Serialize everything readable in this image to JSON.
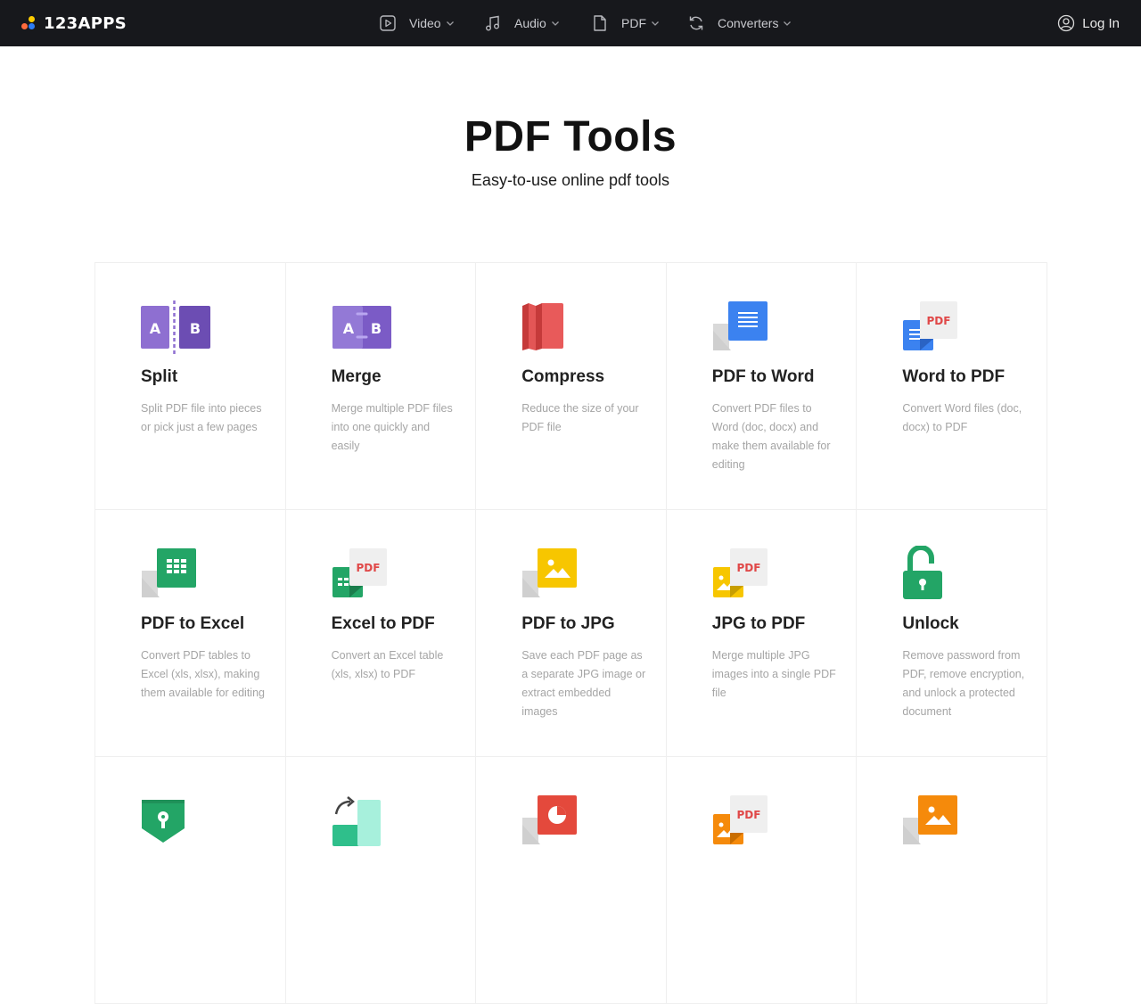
{
  "brand": {
    "name": "123APPS",
    "dot_colors": [
      "#ff6b3d",
      "#2d7cf6",
      "#ffcc00"
    ]
  },
  "nav": {
    "items": [
      {
        "label": "Video",
        "icon": "video-play-icon"
      },
      {
        "label": "Audio",
        "icon": "music-note-icon"
      },
      {
        "label": "PDF",
        "icon": "document-icon"
      },
      {
        "label": "Converters",
        "icon": "convert-cycle-icon"
      }
    ],
    "login_label": "Log In"
  },
  "hero": {
    "title": "PDF Tools",
    "subtitle": "Easy-to-use online pdf tools"
  },
  "tools": [
    {
      "name": "Split",
      "desc": "Split PDF file into pieces or pick just a few pages",
      "icon": "split-icon"
    },
    {
      "name": "Merge",
      "desc": "Merge multiple PDF files into one quickly and easily",
      "icon": "merge-icon"
    },
    {
      "name": "Compress",
      "desc": "Reduce the size of your PDF file",
      "icon": "compress-icon"
    },
    {
      "name": "PDF to Word",
      "desc": "Convert PDF files to Word (doc, docx) and make them available for editing",
      "icon": "pdf-to-word-icon"
    },
    {
      "name": "Word to PDF",
      "desc": "Convert Word files (doc, docx) to PDF",
      "icon": "word-to-pdf-icon"
    },
    {
      "name": "PDF to Excel",
      "desc": "Convert PDF tables to Excel (xls, xlsx), making them available for editing",
      "icon": "pdf-to-excel-icon"
    },
    {
      "name": "Excel to PDF",
      "desc": "Convert an Excel table (xls, xlsx) to PDF",
      "icon": "excel-to-pdf-icon"
    },
    {
      "name": "PDF to JPG",
      "desc": "Save each PDF page as a separate JPG image or extract embedded images",
      "icon": "pdf-to-jpg-icon"
    },
    {
      "name": "JPG to PDF",
      "desc": "Merge multiple JPG images into a single PDF file",
      "icon": "jpg-to-pdf-icon"
    },
    {
      "name": "Unlock",
      "desc": "Remove password from PDF, remove encryption, and unlock a protected document",
      "icon": "unlock-icon"
    },
    {
      "name": "",
      "desc": "",
      "icon": "protect-shield-icon"
    },
    {
      "name": "",
      "desc": "",
      "icon": "rotate-icon"
    },
    {
      "name": "",
      "desc": "",
      "icon": "pdf-to-ppt-icon"
    },
    {
      "name": "",
      "desc": "",
      "icon": "image-to-pdf-icon"
    },
    {
      "name": "",
      "desc": "",
      "icon": "pdf-to-image-icon"
    }
  ]
}
